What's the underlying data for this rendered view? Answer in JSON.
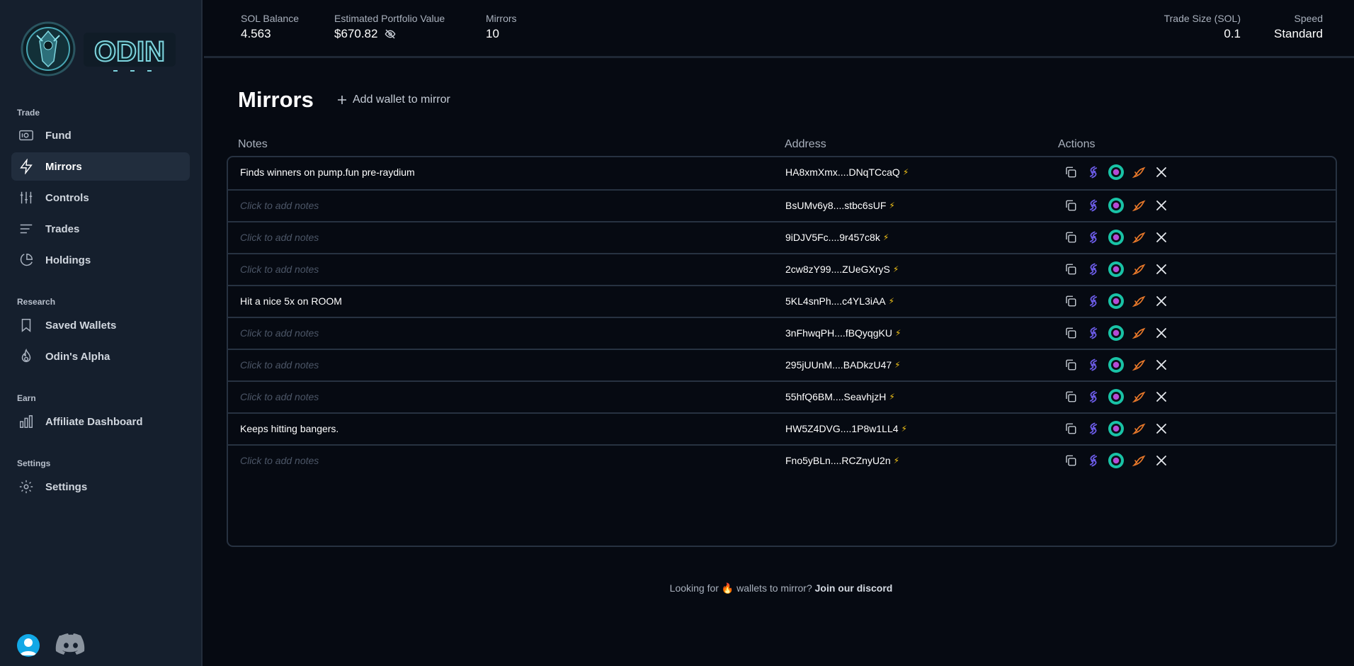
{
  "brand": {
    "name": "ODIN"
  },
  "sidebar": {
    "sections": {
      "trade": "Trade",
      "research": "Research",
      "earn": "Earn",
      "settings": "Settings"
    },
    "items": [
      {
        "label": "Fund",
        "icon": "fund-icon"
      },
      {
        "label": "Mirrors",
        "icon": "lightning-icon",
        "active": true
      },
      {
        "label": "Controls",
        "icon": "sliders-icon"
      },
      {
        "label": "Trades",
        "icon": "list-icon"
      },
      {
        "label": "Holdings",
        "icon": "pie-chart-icon"
      },
      {
        "label": "Saved Wallets",
        "icon": "bookmark-icon"
      },
      {
        "label": "Odin's Alpha",
        "icon": "flame-icon"
      },
      {
        "label": "Affiliate Dashboard",
        "icon": "bar-chart-icon"
      },
      {
        "label": "Settings",
        "icon": "gear-icon"
      }
    ]
  },
  "topbar": {
    "sol_balance_label": "SOL Balance",
    "sol_balance": "4.563",
    "portfolio_label": "Estimated Portfolio Value",
    "portfolio_value": "$670.82",
    "mirrors_label": "Mirrors",
    "mirrors_count": "10",
    "trade_size_label": "Trade Size (SOL)",
    "trade_size": "0.1",
    "speed_label": "Speed",
    "speed": "Standard"
  },
  "main": {
    "title": "Mirrors",
    "add_wallet_label": "Add wallet to mirror",
    "columns": {
      "notes": "Notes",
      "address": "Address",
      "actions": "Actions"
    },
    "placeholder_note": "Click to add notes",
    "rows": [
      {
        "note": "Finds winners on pump.fun pre-raydium",
        "address": "HA8xmXmx....DNqTCcaQ"
      },
      {
        "note": "",
        "address": "BsUMv6y8....stbc6sUF"
      },
      {
        "note": "",
        "address": "9iDJV5Fc....9r457c8k"
      },
      {
        "note": "",
        "address": "2cw8zY99....ZUeGXryS"
      },
      {
        "note": "Hit a nice 5x on ROOM",
        "address": "5KL4snPh....c4YL3iAA"
      },
      {
        "note": "",
        "address": "3nFhwqPH....fBQyqgKU"
      },
      {
        "note": "",
        "address": "295jUUnM....BADkzU47"
      },
      {
        "note": "",
        "address": "55hfQ6BM....SeavhjzH"
      },
      {
        "note": "Keeps hitting bangers.",
        "address": "HW5Z4DVG....1P8w1LL4"
      },
      {
        "note": "",
        "address": "Fno5yBLn....RCZnyU2n"
      }
    ],
    "bolt_glyph": "⚡"
  },
  "footer": {
    "text_before": "Looking for",
    "emoji": "🔥",
    "text_after": "wallets to mirror?",
    "link": "Join our discord"
  },
  "colors": {
    "background": "#060a12",
    "sidebar": "#151f2d",
    "accent_teal": "#19c3a6",
    "accent_purple": "#6c5ce7",
    "accent_orange": "#e8782a",
    "bolt": "#f5c518"
  }
}
